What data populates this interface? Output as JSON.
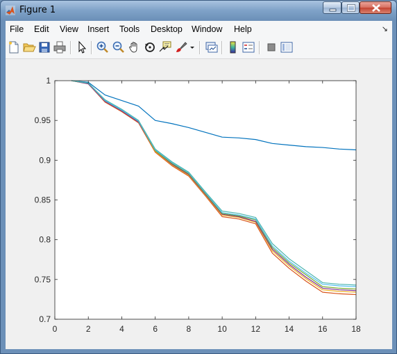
{
  "window": {
    "title": "Figure 1",
    "controls": [
      "minimize-icon",
      "maximize-icon",
      "close-icon"
    ]
  },
  "menubar": {
    "items": [
      "File",
      "Edit",
      "View",
      "Insert",
      "Tools",
      "Desktop",
      "Window",
      "Help"
    ],
    "overflow_icon": "dock-arrow-icon"
  },
  "toolbar": {
    "buttons": [
      {
        "name": "new-figure",
        "icon": "new-file-icon"
      },
      {
        "name": "open-file",
        "icon": "folder-open-icon"
      },
      {
        "name": "save-figure",
        "icon": "save-icon"
      },
      {
        "name": "print-figure",
        "icon": "print-icon"
      },
      {
        "name": "edit-plot",
        "icon": "pointer-arrow-icon"
      },
      {
        "name": "zoom-in",
        "icon": "zoom-in-icon"
      },
      {
        "name": "zoom-out",
        "icon": "zoom-out-icon"
      },
      {
        "name": "pan",
        "icon": "pan-hand-icon"
      },
      {
        "name": "rotate-3d",
        "icon": "rotate-icon"
      },
      {
        "name": "data-cursor",
        "icon": "data-cursor-icon"
      },
      {
        "name": "brush",
        "icon": "brush-icon"
      },
      {
        "name": "link-plot",
        "icon": "link-plot-icon"
      },
      {
        "name": "insert-colorbar",
        "icon": "colorbar-icon"
      },
      {
        "name": "insert-legend",
        "icon": "legend-icon"
      },
      {
        "name": "hide-plot-tools",
        "icon": "hide-tools-icon"
      },
      {
        "name": "show-plot-tools",
        "icon": "show-tools-icon"
      }
    ]
  },
  "chart_data": {
    "type": "line",
    "title": "",
    "xlabel": "",
    "ylabel": "",
    "xlim": [
      0,
      18
    ],
    "ylim": [
      0.7,
      1.0
    ],
    "xticks": [
      "0",
      "2",
      "4",
      "6",
      "8",
      "10",
      "12",
      "14",
      "16",
      "18"
    ],
    "yticks": [
      "0.7",
      "0.75",
      "0.8",
      "0.85",
      "0.9",
      "0.95",
      "1"
    ],
    "grid": false,
    "legend": "none",
    "x": [
      1,
      2,
      3,
      4,
      5,
      6,
      7,
      8,
      9,
      10,
      11,
      12,
      13,
      14,
      15,
      16,
      17,
      18
    ],
    "series": [
      {
        "color": "#0072bd",
        "values": [
          1.0,
          0.998,
          0.982,
          0.975,
          0.968,
          0.95,
          0.946,
          0.941,
          0.935,
          0.929,
          0.928,
          0.926,
          0.921,
          0.919,
          0.917,
          0.916,
          0.914,
          0.913
        ]
      },
      {
        "color": "#d95319",
        "values": [
          1.0,
          0.996,
          0.973,
          0.961,
          0.947,
          0.91,
          0.893,
          0.88,
          0.855,
          0.829,
          0.826,
          0.82,
          0.783,
          0.764,
          0.748,
          0.734,
          0.732,
          0.731
        ]
      },
      {
        "color": "#edb120",
        "values": [
          1.0,
          0.996,
          0.974,
          0.962,
          0.948,
          0.911,
          0.894,
          0.881,
          0.856,
          0.831,
          0.828,
          0.822,
          0.786,
          0.767,
          0.751,
          0.737,
          0.735,
          0.734
        ]
      },
      {
        "color": "#7e2f8e",
        "values": [
          1.0,
          0.996,
          0.974,
          0.962,
          0.948,
          0.912,
          0.895,
          0.882,
          0.857,
          0.832,
          0.829,
          0.823,
          0.788,
          0.769,
          0.753,
          0.739,
          0.737,
          0.736
        ]
      },
      {
        "color": "#77ac30",
        "values": [
          1.0,
          0.997,
          0.975,
          0.963,
          0.949,
          0.912,
          0.896,
          0.883,
          0.858,
          0.833,
          0.83,
          0.825,
          0.79,
          0.771,
          0.756,
          0.741,
          0.739,
          0.738
        ]
      },
      {
        "color": "#4dbeee",
        "values": [
          1.0,
          0.997,
          0.975,
          0.963,
          0.949,
          0.913,
          0.897,
          0.884,
          0.859,
          0.834,
          0.831,
          0.826,
          0.792,
          0.773,
          0.758,
          0.744,
          0.742,
          0.741
        ]
      },
      {
        "color": "#4db5b0",
        "values": [
          1.0,
          0.997,
          0.976,
          0.964,
          0.95,
          0.914,
          0.898,
          0.885,
          0.86,
          0.836,
          0.833,
          0.828,
          0.795,
          0.776,
          0.761,
          0.746,
          0.744,
          0.743
        ]
      }
    ]
  }
}
